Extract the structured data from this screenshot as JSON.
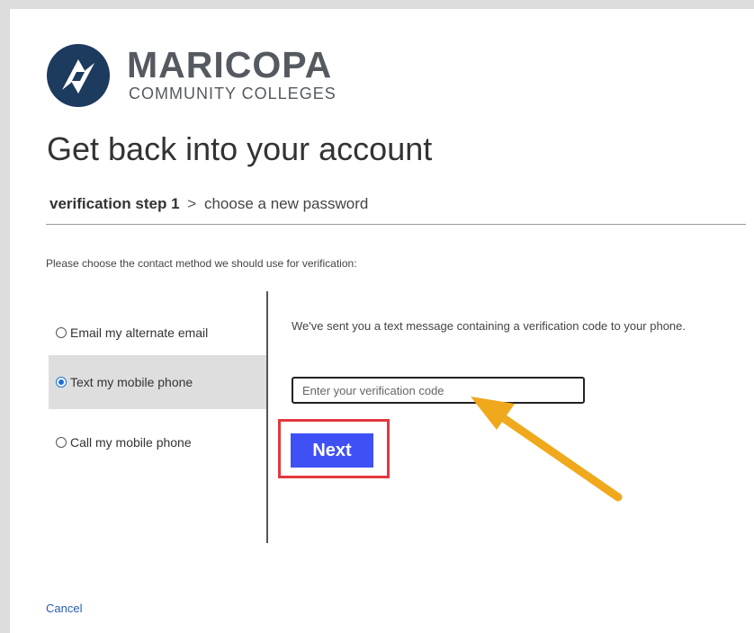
{
  "brand": {
    "name": "MARICOPA",
    "subtitle": "COMMUNITY COLLEGES",
    "logo_icon": "maricopa-logo-icon",
    "color": "#555a60"
  },
  "page": {
    "title": "Get back into your account"
  },
  "steps": {
    "current": "verification step 1",
    "separator": ">",
    "next": "choose a new password"
  },
  "instruction": "Please choose the contact method we should use for verification:",
  "methods": [
    {
      "label": "Email my alternate email",
      "selected": false
    },
    {
      "label": "Text my mobile phone",
      "selected": true
    },
    {
      "label": "Call my mobile phone",
      "selected": false
    }
  ],
  "verification": {
    "message": "We've sent you a text message containing a verification code to your phone.",
    "input_placeholder": "Enter your verification code",
    "input_value": ""
  },
  "actions": {
    "next_label": "Next",
    "next_color": "#3f51f5",
    "cancel_label": "Cancel"
  },
  "annotations": {
    "highlight_color": "#e0393e",
    "arrow_color": "#f0a81c"
  }
}
